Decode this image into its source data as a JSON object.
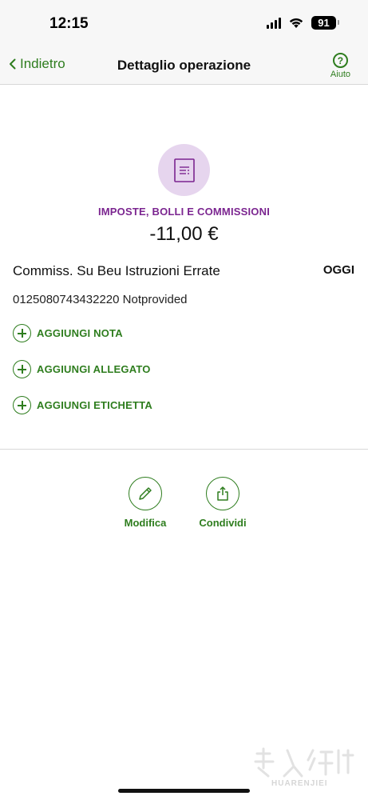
{
  "status_bar": {
    "time": "12:15",
    "battery": "91",
    "icons": [
      "signal-icon",
      "wifi-icon",
      "battery-icon"
    ]
  },
  "nav": {
    "back_label": "Indietro",
    "title": "Dettaglio operazione",
    "help_label": "Aiuto",
    "help_glyph": "?"
  },
  "transaction": {
    "category": "IMPOSTE, BOLLI E COMMISSIONI",
    "amount": "-11,00 €",
    "description": "Commiss. Su Beu Istruzioni Errate",
    "date": "OGGI",
    "reference": "0125080743432220 Notprovided"
  },
  "actions": [
    {
      "label": "AGGIUNGI NOTA"
    },
    {
      "label": "AGGIUNGI ALLEGATO"
    },
    {
      "label": "AGGIUNGI ETICHETTA"
    }
  ],
  "bottom_actions": [
    {
      "label": "Modifica",
      "icon": "pencil-icon"
    },
    {
      "label": "Condividi",
      "icon": "share-icon"
    }
  ],
  "watermark": {
    "text": "HUARENJIEI"
  },
  "colors": {
    "accent_green": "#2e7d1e",
    "category_purple": "#7b2590",
    "category_bg": "#e6d5ee"
  }
}
